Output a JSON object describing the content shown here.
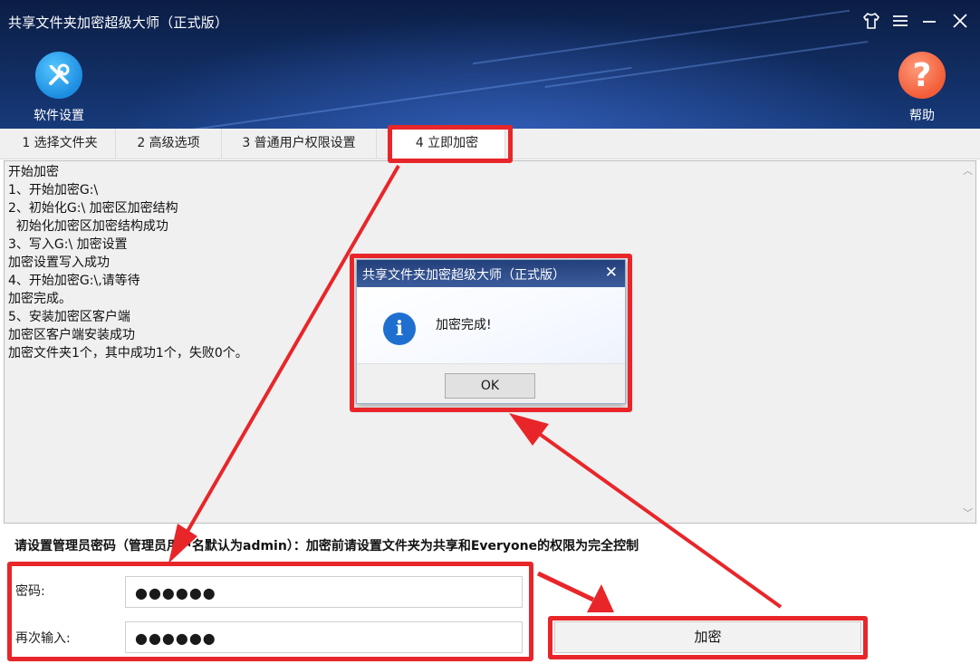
{
  "window": {
    "title": "共享文件夹加密超级大师（正式版）",
    "controls": {
      "skin_icon": "shirt-icon",
      "menu_icon": "menu-icon",
      "minimize_icon": "minimize-icon",
      "close_icon": "close-icon"
    }
  },
  "toolbar": {
    "settings_label": "软件设置",
    "settings_icon": "wrench-screwdriver-icon",
    "help_label": "帮助",
    "help_icon": "question-mark-icon"
  },
  "tabs": [
    {
      "label": "1 选择文件夹"
    },
    {
      "label": "2 高级选项"
    },
    {
      "label": "3 普通用户权限设置"
    },
    {
      "label": "4 立即加密",
      "active": true
    }
  ],
  "log": {
    "lines": [
      "开始加密",
      "1、开始加密G:\\",
      "2、初始化G:\\ 加密区加密结构",
      "  初始化加密区加密结构成功",
      "3、写入G:\\ 加密设置",
      "加密设置写入成功",
      "4、开始加密G:\\,请等待",
      "加密完成。",
      "5、安装加密区客户端",
      "加密区客户端安装成功",
      "加密文件夹1个，其中成功1个，失败0个。"
    ]
  },
  "form": {
    "notice": "请设置管理员密码（管理员用户名默认为admin）：加密前请设置文件夹为共享和Everyone的权限为完全控制",
    "password_label": "密码:",
    "password_value": "●●●●●●",
    "confirm_label": "再次输入:",
    "confirm_value": "●●●●●●",
    "encrypt_button": "加密"
  },
  "dialog": {
    "title": "共享文件夹加密超级大师（正式版）",
    "icon": "info-icon",
    "message": "加密完成!",
    "ok_label": "OK"
  },
  "colors": {
    "header_bg": "#102a5c",
    "annotation": "#e8262a",
    "settings_accent": "#1c8de0",
    "help_accent": "#f25c37"
  }
}
